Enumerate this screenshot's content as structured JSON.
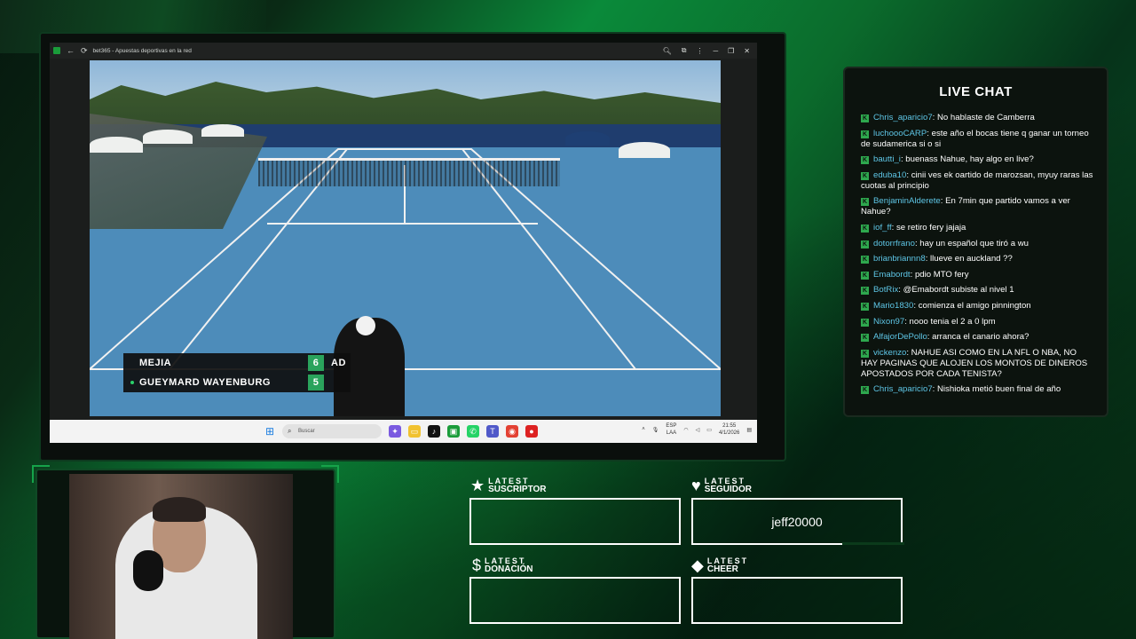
{
  "browser": {
    "tab_title": "bet365 - Apuestas deportivas en la red",
    "icons": [
      "back-icon",
      "reload-icon",
      "zoom-icon",
      "extensions-icon",
      "more-icon",
      "minimize-icon",
      "restore-icon",
      "close-icon"
    ]
  },
  "scoreboard": {
    "players": [
      {
        "name": "MEJIA",
        "set": "6",
        "point": "AD",
        "serving": false
      },
      {
        "name": "GUEYMARD WAYENBURG",
        "set": "5",
        "point": "",
        "serving": true
      }
    ],
    "colors": {
      "set_bg": "#2aa35c",
      "serve_dot": "#2ad06a"
    }
  },
  "taskbar": {
    "search_placeholder": "Buscar",
    "tray": {
      "lang_top": "ESP",
      "lang_bottom": "LAA",
      "time": "21:55",
      "date": "4/1/2026"
    }
  },
  "chat": {
    "title": "LIVE CHAT",
    "messages": [
      {
        "user": "Chris_aparicio7",
        "text": "No hablaste de Camberra"
      },
      {
        "user": "luchoooCARP",
        "text": "este año el bocas tiene q ganar un torneo de sudamerica si o si"
      },
      {
        "user": "bautti_i",
        "text": "buenass Nahue, hay algo en live?"
      },
      {
        "user": "eduba10",
        "text": "cinii ves ek oartido de marozsan, myuy raras las cuotas al principio"
      },
      {
        "user": "BenjaminAlderete",
        "text": "En 7min que partido vamos a ver Nahue?"
      },
      {
        "user": "iof_ff",
        "text": "se retiro fery jajaja"
      },
      {
        "user": "dotorrfrano",
        "text": "hay un español que tiró a wu"
      },
      {
        "user": "brianbriannn8",
        "text": "llueve en auckland ??"
      },
      {
        "user": "Emabordt",
        "text": "pdio MTO fery"
      },
      {
        "user": "BotRix",
        "text": "@Emabordt subiste al nivel 1"
      },
      {
        "user": "Mario1830",
        "text": "comienza el amigo pinnington"
      },
      {
        "user": "Nixon97",
        "text": "nooo tenia el 2 a 0 lpm"
      },
      {
        "user": "AlfajorDePollo",
        "text": "arranca el canario ahora?"
      },
      {
        "user": "vickenzo",
        "text": "NAHUE ASI COMO EN LA NFL O NBA, NO HAY PAGINAS QUE ALOJEN LOS MONTOS DE DINEROS APOSTADOS POR CADA TENISTA?"
      },
      {
        "user": "Chris_aparicio7",
        "text": "Nishioka metió buen final de año"
      }
    ],
    "colors": {
      "username": "#5ec6e6",
      "badge": "#2ea84e"
    }
  },
  "widgets": {
    "suscriptor": {
      "line1": "LATEST",
      "line2": "SUSCRIPTOR",
      "value": ""
    },
    "seguidor": {
      "line1": "LATEST",
      "line2": "SEGUIDOR",
      "value": "jeff20000"
    },
    "donacion": {
      "line1": "LATEST",
      "line2": "DONACIÓN",
      "value": ""
    },
    "cheer": {
      "line1": "LATEST",
      "line2": "CHEER",
      "value": ""
    }
  }
}
